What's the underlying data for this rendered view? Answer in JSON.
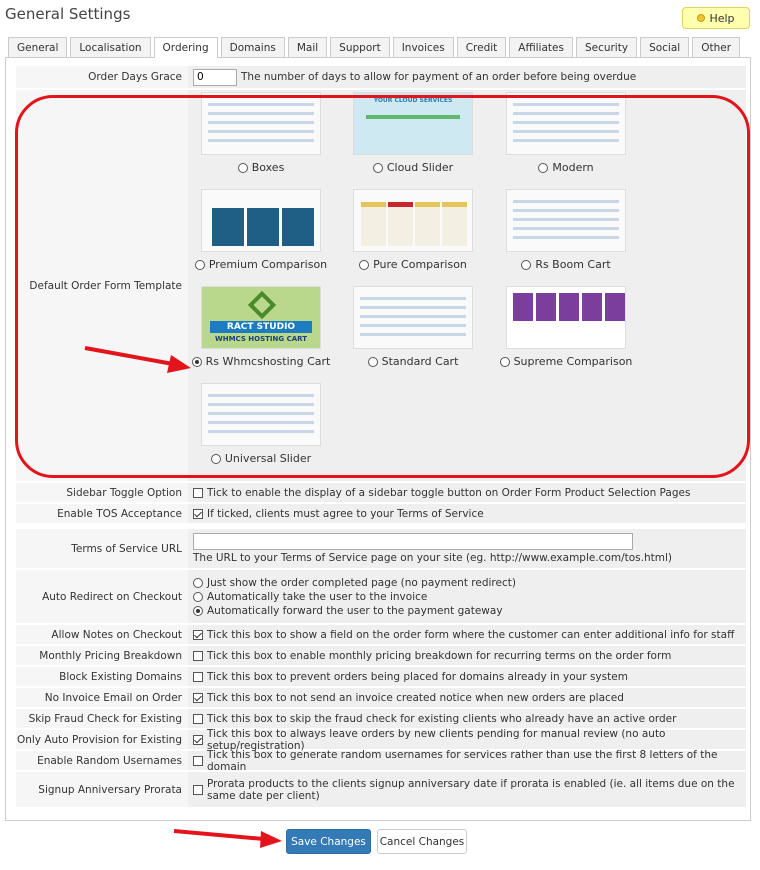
{
  "page": {
    "title": "General Settings",
    "help_label": "Help"
  },
  "tabs": [
    "General",
    "Localisation",
    "Ordering",
    "Domains",
    "Mail",
    "Support",
    "Invoices",
    "Credit",
    "Affiliates",
    "Security",
    "Social",
    "Other"
  ],
  "active_tab": "Ordering",
  "order_days_grace": {
    "label": "Order Days Grace",
    "value": "0",
    "description": "The number of days to allow for payment of an order before being overdue"
  },
  "order_form_template": {
    "label": "Default Order Form Template",
    "selected": "Rs Whmcshosting Cart",
    "options": [
      "Boxes",
      "Cloud Slider",
      "Modern",
      "Premium Comparison",
      "Pure Comparison",
      "Rs Boom Cart",
      "Rs Whmcshosting Cart",
      "Standard Cart",
      "Supreme Comparison",
      "Universal Slider"
    ],
    "thumb_text": {
      "ract": "RACT STUDIO",
      "whmcs": "WHMCS HOSTING CART",
      "cloud": "YOUR CLOUD SERVICES"
    }
  },
  "settings": [
    {
      "label": "Sidebar Toggle Option",
      "checked": false,
      "text": "Tick to enable the display of a sidebar toggle button on Order Form Product Selection Pages"
    },
    {
      "label": "Enable TOS Acceptance",
      "checked": true,
      "text": "If ticked, clients must agree to your Terms of Service"
    }
  ],
  "tos_url": {
    "label": "Terms of Service URL",
    "value": "",
    "description": "The URL to your Terms of Service page on your site (eg. http://www.example.com/tos.html)"
  },
  "auto_redirect": {
    "label": "Auto Redirect on Checkout",
    "options": [
      "Just show the order completed page (no payment redirect)",
      "Automatically take the user to the invoice",
      "Automatically forward the user to the payment gateway"
    ],
    "selected_index": 2
  },
  "settings2": [
    {
      "label": "Allow Notes on Checkout",
      "checked": true,
      "text": "Tick this box to show a field on the order form where the customer can enter additional info for staff"
    },
    {
      "label": "Monthly Pricing Breakdown",
      "checked": false,
      "text": "Tick this box to enable monthly pricing breakdown for recurring terms on the order form"
    },
    {
      "label": "Block Existing Domains",
      "checked": false,
      "text": "Tick this box to prevent orders being placed for domains already in your system"
    },
    {
      "label": "No Invoice Email on Order",
      "checked": true,
      "text": "Tick this box to not send an invoice created notice when new orders are placed"
    },
    {
      "label": "Skip Fraud Check for Existing",
      "checked": false,
      "text": "Tick this box to skip the fraud check for existing clients who already have an active order"
    },
    {
      "label": "Only Auto Provision for Existing",
      "checked": true,
      "text": "Tick this box to always leave orders by new clients pending for manual review (no auto setup/registration)"
    },
    {
      "label": "Enable Random Usernames",
      "checked": false,
      "text": "Tick this box to generate random usernames for services rather than use the first 8 letters of the domain"
    },
    {
      "label": "Signup Anniversary Prorata",
      "checked": false,
      "text": "Prorata products to the clients signup anniversary date if prorata is enabled (ie. all items due on the same date per client)"
    }
  ],
  "buttons": {
    "save": "Save Changes",
    "cancel": "Cancel Changes"
  },
  "colors": {
    "highlight": "#e3141b",
    "primary": "#337ab7",
    "help_bg": "#ffffb0"
  }
}
